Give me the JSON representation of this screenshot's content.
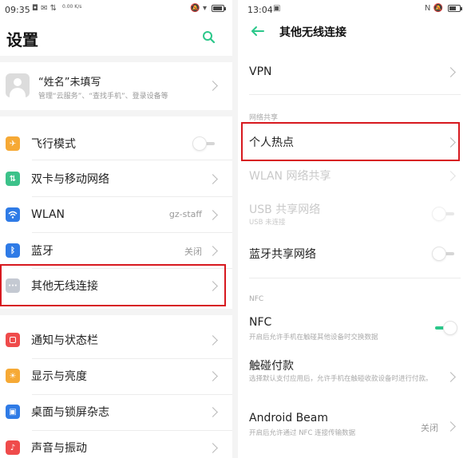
{
  "left": {
    "status": {
      "time": "09:35",
      "icons": "◘ ✉ ⇅",
      "net_speed": "0.00 K/s",
      "right_icons": "🔕 ▾"
    },
    "title": "设置",
    "profile": {
      "name": "“姓名”未填写",
      "sub": "管理“云服务”、“查找手机”、登录设备等"
    },
    "items": [
      {
        "label": "飞行模式",
        "icon": "airplane-icon",
        "color": "#f6a935"
      },
      {
        "label": "双卡与移动网络",
        "icon": "sim-icon",
        "color": "#3cc28a"
      },
      {
        "label": "WLAN",
        "icon": "wifi-icon",
        "color": "#2f7be6",
        "value": "gz-staff"
      },
      {
        "label": "蓝牙",
        "icon": "bluetooth-icon",
        "color": "#2f7be6",
        "value": "关闭"
      },
      {
        "label": "其他无线连接",
        "icon": "more-icon",
        "color": "#c4c9d2"
      },
      {
        "label": "通知与状态栏",
        "icon": "notification-icon",
        "color": "#ef4b4b"
      },
      {
        "label": "显示与亮度",
        "icon": "brightness-icon",
        "color": "#f6a935"
      },
      {
        "label": "桌面与锁屏杂志",
        "icon": "wallpaper-icon",
        "color": "#2f7be6"
      },
      {
        "label": "声音与振动",
        "icon": "sound-icon",
        "color": "#ef4b4b"
      }
    ]
  },
  "right": {
    "status": {
      "time": "13:04",
      "icons": "▣",
      "right_icons": "N 🔕"
    },
    "title": "其他无线连接",
    "vpn": "VPN",
    "section_hotspot": "网络共享",
    "hotspot": "个人热点",
    "wlan_share": "WLAN 网络共享",
    "usb_share": "USB 共享网络",
    "usb_share_sub": "USB 未连接",
    "bt_share": "蓝牙共享网络",
    "section_nfc": "NFC",
    "nfc": "NFC",
    "nfc_sub": "开启后允许手机在触碰其他设备时交换数据",
    "pay": "触碰付款",
    "pay_sub": "选择默认支付应用后，允许手机在触碰收款设备时进行付款。",
    "beam": "Android Beam",
    "beam_sub": "开启后允许通过 NFC 连接传输数据",
    "beam_value": "关闭"
  },
  "colors": {
    "accent": "#2bc78a",
    "highlight": "#d7191f"
  }
}
